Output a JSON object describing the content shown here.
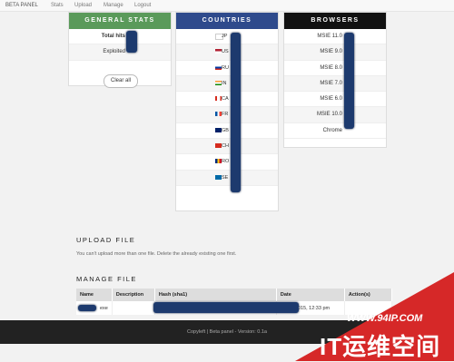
{
  "nav": {
    "brand": "BETA PANEL",
    "items": [
      "Stats",
      "Upload",
      "Manage",
      "Logout"
    ]
  },
  "general_stats": {
    "title": "GENERAL STATS",
    "rows": [
      {
        "label": "Total hits"
      },
      {
        "label": "Exploited"
      }
    ],
    "clear_button": "Clear all"
  },
  "countries": {
    "title": "COUNTRIES",
    "rows": [
      {
        "flag": "jp-flag",
        "code": "JP"
      },
      {
        "flag": "us-flag",
        "code": "US"
      },
      {
        "flag": "ru-flag",
        "code": "RU"
      },
      {
        "flag": "in-flag",
        "code": "IN"
      },
      {
        "flag": "ca-flag",
        "code": "CA"
      },
      {
        "flag": "fr-flag",
        "code": "FR"
      },
      {
        "flag": "gb-flag",
        "code": "GB"
      },
      {
        "flag": "ch-flag",
        "code": "CH"
      },
      {
        "flag": "ro-flag",
        "code": "RO"
      },
      {
        "flag": "se-flag",
        "code": "SE"
      }
    ]
  },
  "browsers": {
    "title": "BROWSERS",
    "rows": [
      "MSIE 11.0",
      "MSIE 9.0",
      "MSIE 8.0",
      "MSIE 7.0",
      "MSIE 6.0",
      "MSIE 10.0",
      "Chrome"
    ]
  },
  "upload": {
    "title": "UPLOAD FILE",
    "note": "You can't upload more than one file. Delete the already existing one first."
  },
  "manage": {
    "title": "MANAGE FILE",
    "columns": [
      "Name",
      "Description",
      "Hash (sha1)",
      "Date",
      "Action(s)"
    ],
    "row": {
      "name_suffix": "exe",
      "date": "2015, 12:33 pm"
    }
  },
  "footer": "Copyleft | Beta panel - Version: 0.1a",
  "watermark": {
    "url": "WWW.94IP.COM",
    "text": "IT运维空间"
  },
  "colors": {
    "green_header": "#5a9a5a",
    "blue_header": "#2e4a8c",
    "black_header": "#111111",
    "redaction": "#1d3a6e",
    "watermark_red": "#d62828"
  }
}
